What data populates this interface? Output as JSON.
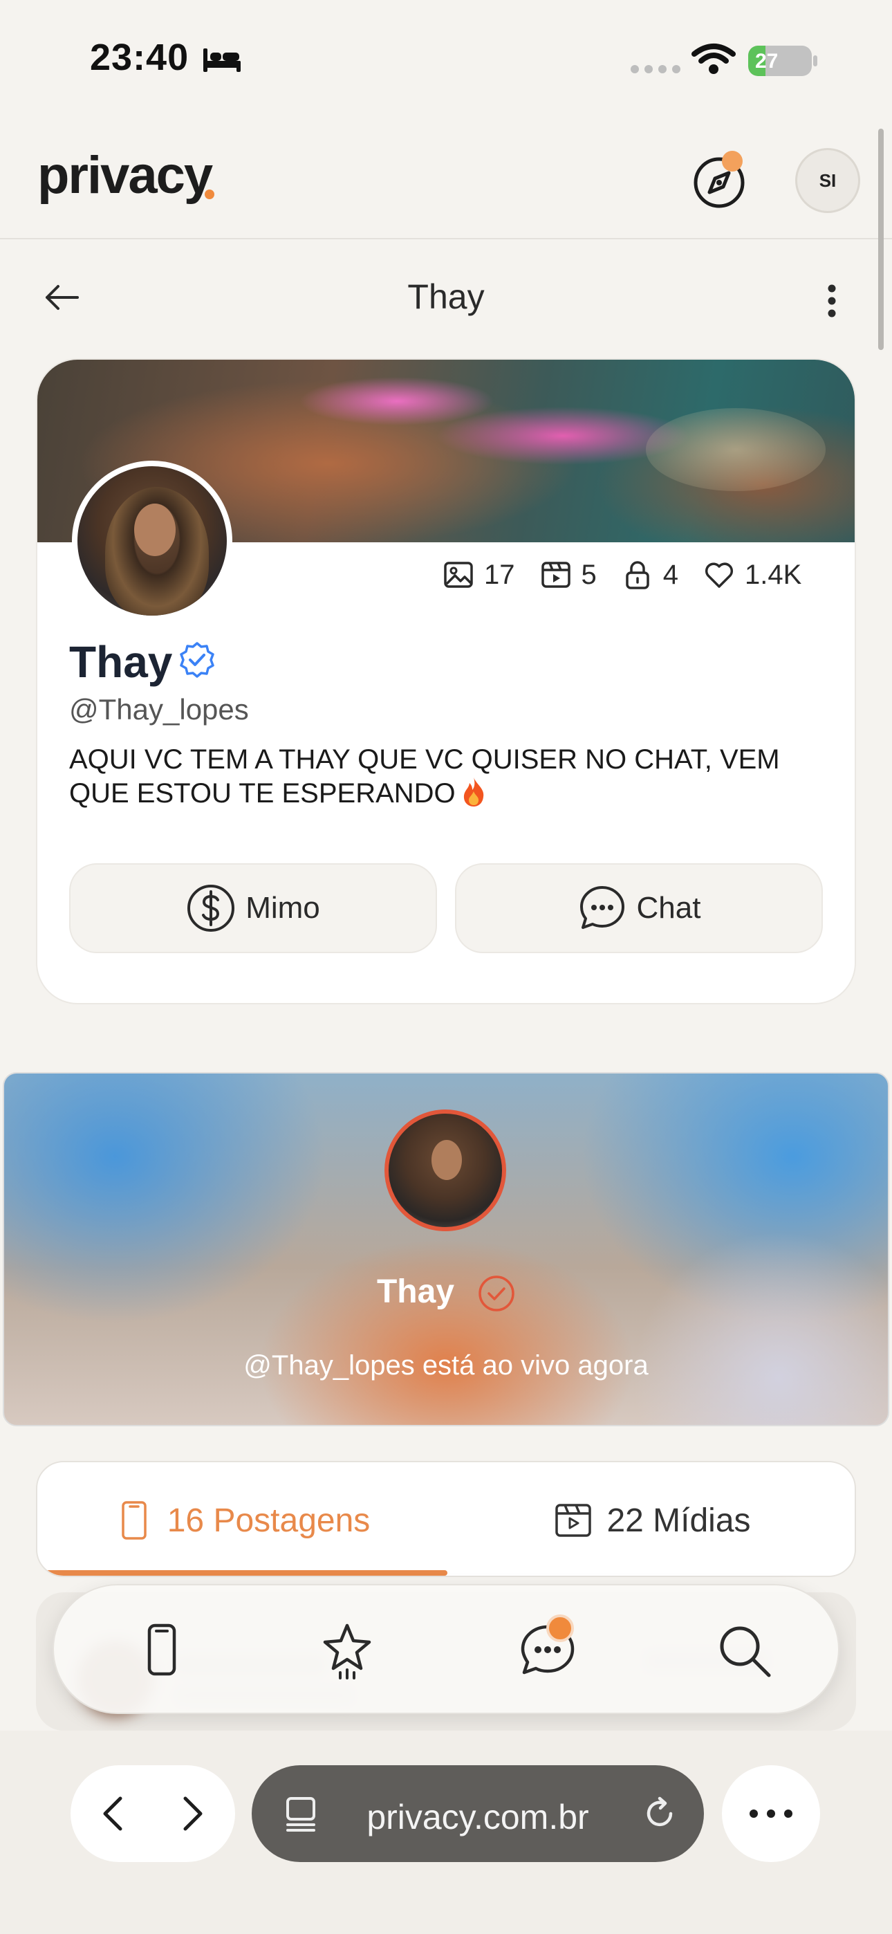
{
  "status_bar": {
    "time": "23:40",
    "battery": "27",
    "battery_level": 0.27
  },
  "header": {
    "logo": "privacy",
    "avatar_initials": "SI"
  },
  "page": {
    "title": "Thay"
  },
  "profile": {
    "name": "Thay",
    "handle": "@Thay_lopes",
    "bio": "AQUI VC TEM A THAY QUE VC QUISER NO CHAT, VEM QUE ESTOU TE ESPERANDO",
    "stats": {
      "photos": "17",
      "videos": "5",
      "locked": "4",
      "likes": "1.4K"
    },
    "buttons": {
      "tip": "Mimo",
      "chat": "Chat"
    }
  },
  "live": {
    "name": "Thay",
    "status": "@Thay_lopes está ao vivo agora"
  },
  "tabs": {
    "posts": "16 Postagens",
    "media": "22 Mídias"
  },
  "browser": {
    "url": "privacy.com.br"
  },
  "colors": {
    "accent": "#f08a3c",
    "verified": "#3b82f6",
    "live_ring": "#e2573a"
  }
}
